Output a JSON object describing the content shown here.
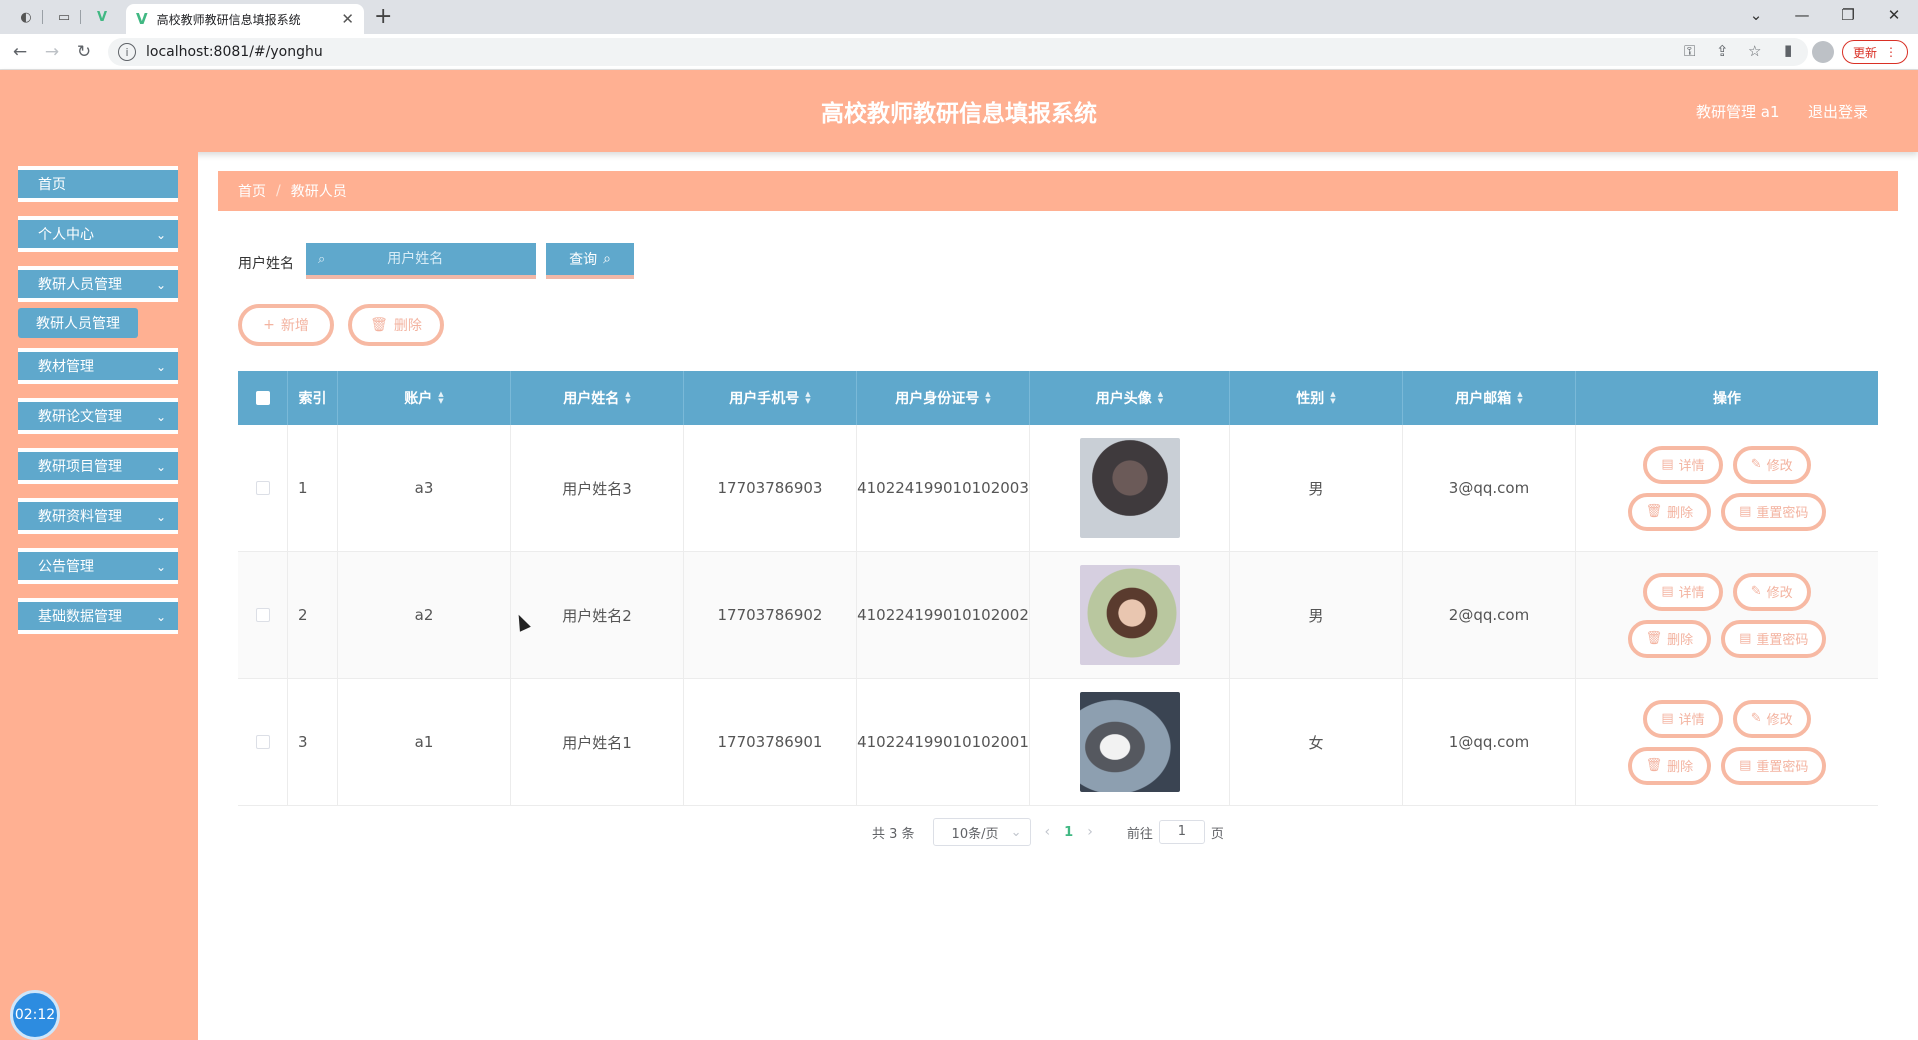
{
  "browser": {
    "tab_title": "高校教师教研信息填报系统",
    "url": "localhost:8081/#/yonghu",
    "update_label": "更新"
  },
  "header": {
    "title": "高校教师教研信息填报系统",
    "user_label": "教研管理 a1",
    "logout_label": "退出登录"
  },
  "sidebar": {
    "items": [
      {
        "label": "首页"
      },
      {
        "label": "个人中心"
      },
      {
        "label": "教研人员管理"
      },
      {
        "label": "教材管理"
      },
      {
        "label": "教研论文管理"
      },
      {
        "label": "教研项目管理"
      },
      {
        "label": "教研资料管理"
      },
      {
        "label": "公告管理"
      },
      {
        "label": "基础数据管理"
      }
    ],
    "active_sub": "教研人员管理",
    "clock": "02:12"
  },
  "breadcrumb": [
    "首页",
    "教研人员"
  ],
  "search": {
    "label": "用户姓名",
    "placeholder": "用户姓名",
    "button_label": "查询"
  },
  "actions": {
    "add_label": "新增",
    "delete_label": "删除"
  },
  "table": {
    "headers": [
      "索引",
      "账户",
      "用户姓名",
      "用户手机号",
      "用户身份证号",
      "用户头像",
      "性别",
      "用户邮箱",
      "操作"
    ],
    "rows": [
      {
        "index": "1",
        "account": "a3",
        "name": "用户姓名3",
        "phone": "17703786903",
        "idcard": "410224199010102003",
        "gender": "男",
        "email": "3@qq.com"
      },
      {
        "index": "2",
        "account": "a2",
        "name": "用户姓名2",
        "phone": "17703786902",
        "idcard": "410224199010102002",
        "gender": "男",
        "email": "2@qq.com"
      },
      {
        "index": "3",
        "account": "a1",
        "name": "用户姓名1",
        "phone": "17703786901",
        "idcard": "410224199010102001",
        "gender": "女",
        "email": "1@qq.com"
      }
    ],
    "row_actions": {
      "detail": "详情",
      "edit": "修改",
      "delete": "删除",
      "reset_password": "重置密码"
    }
  },
  "pagination": {
    "total_text": "共 3 条",
    "page_size": "10条/页",
    "current_page": "1",
    "goto_label": "前往",
    "goto_value": "1",
    "page_suffix": "页"
  },
  "colors": {
    "header_bg": "#ffb092",
    "accent_blue": "#5fa8cc",
    "button_border": "#f7b9a3"
  }
}
